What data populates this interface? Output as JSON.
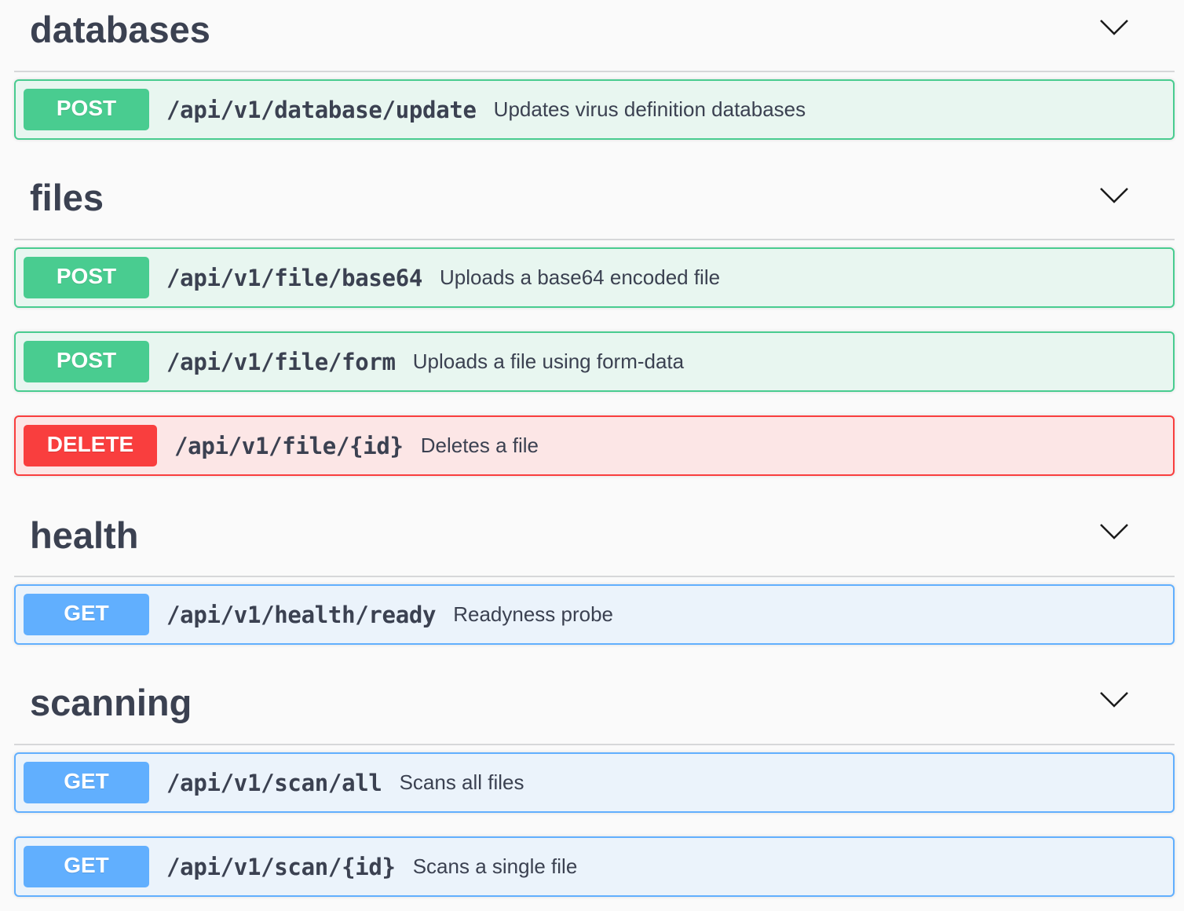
{
  "sections": [
    {
      "title": "databases",
      "operations": [
        {
          "method": "POST",
          "path": "/api/v1/database/update",
          "summary": "Updates virus definition databases"
        }
      ]
    },
    {
      "title": "files",
      "operations": [
        {
          "method": "POST",
          "path": "/api/v1/file/base64",
          "summary": "Uploads a base64 encoded file"
        },
        {
          "method": "POST",
          "path": "/api/v1/file/form",
          "summary": "Uploads a file using form-data"
        },
        {
          "method": "DELETE",
          "path": "/api/v1/file/{id}",
          "summary": "Deletes a file"
        }
      ]
    },
    {
      "title": "health",
      "operations": [
        {
          "method": "GET",
          "path": "/api/v1/health/ready",
          "summary": "Readyness probe"
        }
      ]
    },
    {
      "title": "scanning",
      "operations": [
        {
          "method": "GET",
          "path": "/api/v1/scan/all",
          "summary": "Scans all files"
        },
        {
          "method": "GET",
          "path": "/api/v1/scan/{id}",
          "summary": "Scans a single file"
        }
      ]
    }
  ],
  "icons": {
    "collapse": "chevron-down-icon"
  },
  "colors": {
    "post": "#49cc90",
    "delete": "#f93e3e",
    "get": "#61affe",
    "text": "#3b4151"
  }
}
